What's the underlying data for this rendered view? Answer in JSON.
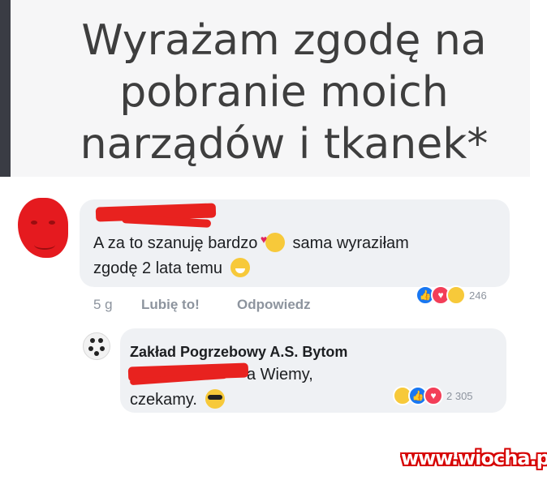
{
  "headline": {
    "line1": "Wyrażam zgodę na",
    "line2": "pobranie moich",
    "line3": "narządów i tkanek*"
  },
  "comment": {
    "text_part1": "A za to szanuję bardzo",
    "emoji1": "smiling-face-with-hearts",
    "text_part2": "sama wyraziłam",
    "text_part3": "zgodę 2 lata temu",
    "emoji2": "grinning-face",
    "time": "5 g",
    "like_label": "Lubię to!",
    "reply_label": "Odpowiedz",
    "reaction_count": "246",
    "reactions": [
      "like",
      "love",
      "haha"
    ]
  },
  "reply": {
    "author": "Zakład Pogrzebowy A.S. Bytom",
    "text_suffix": "a Wiemy,",
    "text_line2": "czekamy.",
    "emoji": "smiling-face-with-sunglasses",
    "reaction_count": "2 305",
    "reactions": [
      "haha",
      "like",
      "love"
    ]
  },
  "colors": {
    "redaction": "#e8221f",
    "bubble": "#eff1f4",
    "like_blue": "#1877f2",
    "love_red": "#f33e58",
    "haha_yellow": "#f7c93a",
    "watermark": "#d60000"
  },
  "watermark": "www.wiocha.pl"
}
